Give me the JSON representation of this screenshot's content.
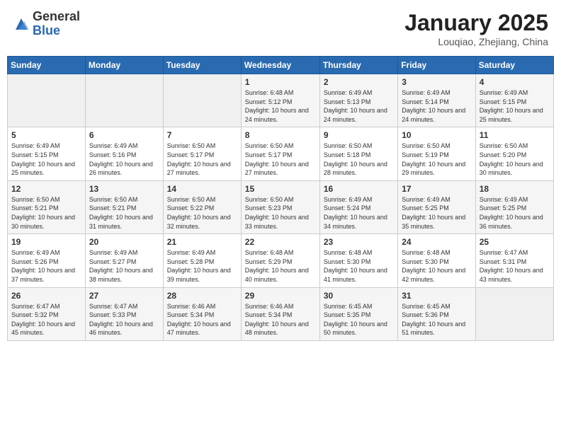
{
  "header": {
    "logo_general": "General",
    "logo_blue": "Blue",
    "month_title": "January 2025",
    "location": "Louqiao, Zhejiang, China"
  },
  "weekdays": [
    "Sunday",
    "Monday",
    "Tuesday",
    "Wednesday",
    "Thursday",
    "Friday",
    "Saturday"
  ],
  "weeks": [
    [
      {
        "num": "",
        "info": ""
      },
      {
        "num": "",
        "info": ""
      },
      {
        "num": "",
        "info": ""
      },
      {
        "num": "1",
        "info": "Sunrise: 6:48 AM\nSunset: 5:12 PM\nDaylight: 10 hours\nand 24 minutes."
      },
      {
        "num": "2",
        "info": "Sunrise: 6:49 AM\nSunset: 5:13 PM\nDaylight: 10 hours\nand 24 minutes."
      },
      {
        "num": "3",
        "info": "Sunrise: 6:49 AM\nSunset: 5:14 PM\nDaylight: 10 hours\nand 24 minutes."
      },
      {
        "num": "4",
        "info": "Sunrise: 6:49 AM\nSunset: 5:15 PM\nDaylight: 10 hours\nand 25 minutes."
      }
    ],
    [
      {
        "num": "5",
        "info": "Sunrise: 6:49 AM\nSunset: 5:15 PM\nDaylight: 10 hours\nand 25 minutes."
      },
      {
        "num": "6",
        "info": "Sunrise: 6:49 AM\nSunset: 5:16 PM\nDaylight: 10 hours\nand 26 minutes."
      },
      {
        "num": "7",
        "info": "Sunrise: 6:50 AM\nSunset: 5:17 PM\nDaylight: 10 hours\nand 27 minutes."
      },
      {
        "num": "8",
        "info": "Sunrise: 6:50 AM\nSunset: 5:17 PM\nDaylight: 10 hours\nand 27 minutes."
      },
      {
        "num": "9",
        "info": "Sunrise: 6:50 AM\nSunset: 5:18 PM\nDaylight: 10 hours\nand 28 minutes."
      },
      {
        "num": "10",
        "info": "Sunrise: 6:50 AM\nSunset: 5:19 PM\nDaylight: 10 hours\nand 29 minutes."
      },
      {
        "num": "11",
        "info": "Sunrise: 6:50 AM\nSunset: 5:20 PM\nDaylight: 10 hours\nand 30 minutes."
      }
    ],
    [
      {
        "num": "12",
        "info": "Sunrise: 6:50 AM\nSunset: 5:21 PM\nDaylight: 10 hours\nand 30 minutes."
      },
      {
        "num": "13",
        "info": "Sunrise: 6:50 AM\nSunset: 5:21 PM\nDaylight: 10 hours\nand 31 minutes."
      },
      {
        "num": "14",
        "info": "Sunrise: 6:50 AM\nSunset: 5:22 PM\nDaylight: 10 hours\nand 32 minutes."
      },
      {
        "num": "15",
        "info": "Sunrise: 6:50 AM\nSunset: 5:23 PM\nDaylight: 10 hours\nand 33 minutes."
      },
      {
        "num": "16",
        "info": "Sunrise: 6:49 AM\nSunset: 5:24 PM\nDaylight: 10 hours\nand 34 minutes."
      },
      {
        "num": "17",
        "info": "Sunrise: 6:49 AM\nSunset: 5:25 PM\nDaylight: 10 hours\nand 35 minutes."
      },
      {
        "num": "18",
        "info": "Sunrise: 6:49 AM\nSunset: 5:25 PM\nDaylight: 10 hours\nand 36 minutes."
      }
    ],
    [
      {
        "num": "19",
        "info": "Sunrise: 6:49 AM\nSunset: 5:26 PM\nDaylight: 10 hours\nand 37 minutes."
      },
      {
        "num": "20",
        "info": "Sunrise: 6:49 AM\nSunset: 5:27 PM\nDaylight: 10 hours\nand 38 minutes."
      },
      {
        "num": "21",
        "info": "Sunrise: 6:49 AM\nSunset: 5:28 PM\nDaylight: 10 hours\nand 39 minutes."
      },
      {
        "num": "22",
        "info": "Sunrise: 6:48 AM\nSunset: 5:29 PM\nDaylight: 10 hours\nand 40 minutes."
      },
      {
        "num": "23",
        "info": "Sunrise: 6:48 AM\nSunset: 5:30 PM\nDaylight: 10 hours\nand 41 minutes."
      },
      {
        "num": "24",
        "info": "Sunrise: 6:48 AM\nSunset: 5:30 PM\nDaylight: 10 hours\nand 42 minutes."
      },
      {
        "num": "25",
        "info": "Sunrise: 6:47 AM\nSunset: 5:31 PM\nDaylight: 10 hours\nand 43 minutes."
      }
    ],
    [
      {
        "num": "26",
        "info": "Sunrise: 6:47 AM\nSunset: 5:32 PM\nDaylight: 10 hours\nand 45 minutes."
      },
      {
        "num": "27",
        "info": "Sunrise: 6:47 AM\nSunset: 5:33 PM\nDaylight: 10 hours\nand 46 minutes."
      },
      {
        "num": "28",
        "info": "Sunrise: 6:46 AM\nSunset: 5:34 PM\nDaylight: 10 hours\nand 47 minutes."
      },
      {
        "num": "29",
        "info": "Sunrise: 6:46 AM\nSunset: 5:34 PM\nDaylight: 10 hours\nand 48 minutes."
      },
      {
        "num": "30",
        "info": "Sunrise: 6:45 AM\nSunset: 5:35 PM\nDaylight: 10 hours\nand 50 minutes."
      },
      {
        "num": "31",
        "info": "Sunrise: 6:45 AM\nSunset: 5:36 PM\nDaylight: 10 hours\nand 51 minutes."
      },
      {
        "num": "",
        "info": ""
      }
    ]
  ]
}
